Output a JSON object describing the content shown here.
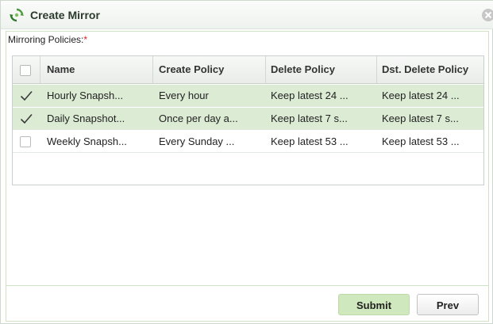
{
  "dialog": {
    "title": "Create Mirror",
    "icon": "recycle-arrows-icon"
  },
  "form": {
    "policies_label": "Mirroring Policies:",
    "required_marker": "*"
  },
  "table": {
    "columns": [
      "Name",
      "Create Policy",
      "Delete Policy",
      "Dst. Delete Policy"
    ],
    "rows": [
      {
        "selected": true,
        "name": "Hourly Snapsh...",
        "create": "Every hour",
        "delete": "Keep latest 24 ...",
        "dst_delete": "Keep latest 24 ..."
      },
      {
        "selected": true,
        "name": "Daily Snapshot...",
        "create": "Once per day a...",
        "delete": "Keep latest 7 s...",
        "dst_delete": "Keep latest 7 s..."
      },
      {
        "selected": false,
        "name": "Weekly Snapsh...",
        "create": "Every Sunday ...",
        "delete": "Keep latest 53 ...",
        "dst_delete": "Keep latest 53 ..."
      }
    ]
  },
  "buttons": {
    "submit": "Submit",
    "prev": "Prev"
  },
  "colors": {
    "selected_row": "#dcebd4",
    "submit_bg": "#cfe8bd",
    "required": "#e02020"
  }
}
